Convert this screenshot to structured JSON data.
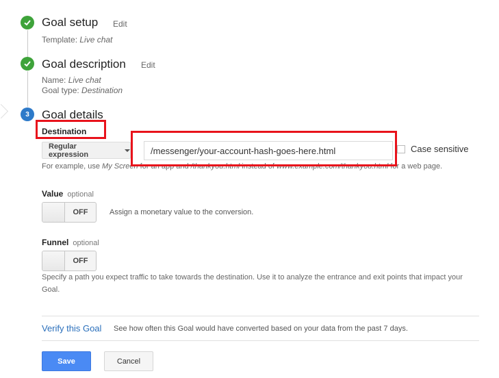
{
  "steps": [
    {
      "title": "Goal setup",
      "edit_label": "Edit",
      "status": "complete",
      "details": [
        {
          "label": "Template: ",
          "value": "Live chat"
        }
      ]
    },
    {
      "title": "Goal description",
      "edit_label": "Edit",
      "status": "complete",
      "details": [
        {
          "label": "Name: ",
          "value": "Live chat"
        },
        {
          "label": "Goal type: ",
          "value": "Destination"
        }
      ]
    },
    {
      "title": "Goal details",
      "number": "3",
      "status": "active"
    }
  ],
  "destination": {
    "label": "Destination",
    "match_type": "Regular expression",
    "value": "/messenger/your-account-hash-goes-here.html",
    "case_sensitive_label": "Case sensitive",
    "case_sensitive_checked": false,
    "help_prefix": "For example, use ",
    "help_em1": "My Screen",
    "help_mid1": " for an app and ",
    "help_em2": "/thankyou.html",
    "help_mid2": " instead of ",
    "help_em3": "www.example.com/thankyou.html",
    "help_suffix": " for a web page."
  },
  "value_section": {
    "label": "Value",
    "optional": "optional",
    "toggle_state": "OFF",
    "description": "Assign a monetary value to the conversion."
  },
  "funnel_section": {
    "label": "Funnel",
    "optional": "optional",
    "toggle_state": "OFF",
    "description": "Specify a path you expect traffic to take towards the destination. Use it to analyze the entrance and exit points that impact your Goal."
  },
  "verify": {
    "link": "Verify this Goal",
    "description": "See how often this Goal would have converted based on your data from the past 7 days."
  },
  "actions": {
    "save": "Save",
    "cancel": "Cancel"
  },
  "colors": {
    "check_green": "#3ea33a",
    "step_blue": "#2e7ac9",
    "link_blue": "#2a6fbb",
    "save_blue": "#4a8af4",
    "highlight_red": "#e8121b"
  }
}
